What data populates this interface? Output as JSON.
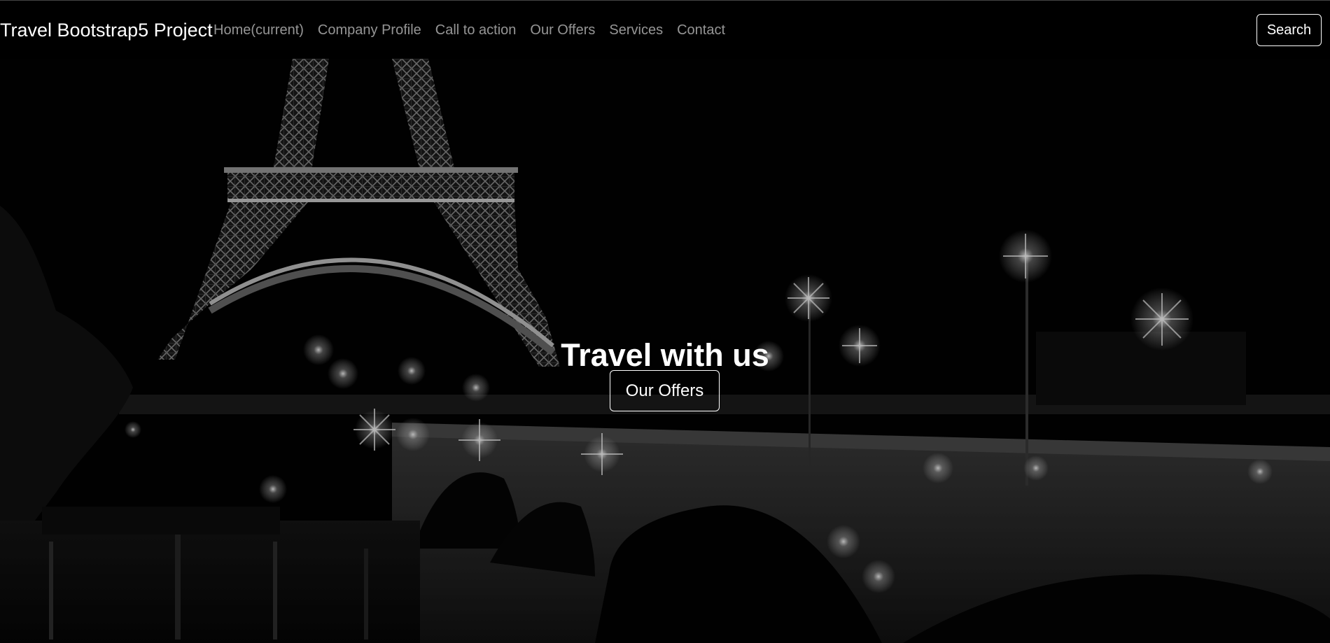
{
  "navbar": {
    "brand": "Travel Bootstrap5 Project",
    "links": [
      "Home(current)",
      "Company Profile",
      "Call to action",
      "Our Offers",
      "Services",
      "Contact"
    ],
    "search_label": "Search"
  },
  "hero": {
    "title": "Travel with us",
    "button_label": "Our Offers",
    "background_image": "eiffel-tower-night-bridge"
  }
}
